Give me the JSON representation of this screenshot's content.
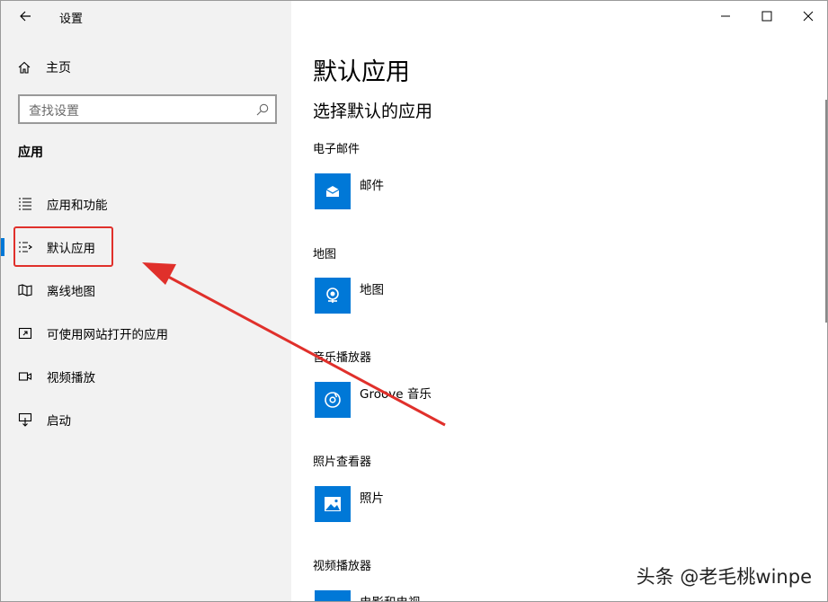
{
  "window": {
    "title": "设置"
  },
  "sidebar": {
    "home_label": "主页",
    "search_placeholder": "查找设置",
    "section_label": "应用",
    "items": [
      {
        "label": "应用和功能",
        "icon": "list-icon"
      },
      {
        "label": "默认应用",
        "icon": "default-apps-icon",
        "active": true
      },
      {
        "label": "离线地图",
        "icon": "map-icon"
      },
      {
        "label": "可使用网站打开的应用",
        "icon": "open-external-icon"
      },
      {
        "label": "视频播放",
        "icon": "video-icon"
      },
      {
        "label": "启动",
        "icon": "startup-icon"
      }
    ]
  },
  "main": {
    "title": "默认应用",
    "subtitle": "选择默认的应用",
    "categories": [
      {
        "label": "电子邮件",
        "app": "邮件",
        "icon": "mail-icon"
      },
      {
        "label": "地图",
        "app": "地图",
        "icon": "maps-icon"
      },
      {
        "label": "音乐播放器",
        "app": "Groove 音乐",
        "icon": "groove-music-icon"
      },
      {
        "label": "照片查看器",
        "app": "照片",
        "icon": "photos-icon"
      },
      {
        "label": "视频播放器",
        "app": "电影和电视",
        "icon": "movies-tv-icon"
      }
    ]
  },
  "watermark": "头条 @老毛桃winpe",
  "colors": {
    "accent": "#0078d7",
    "annotation": "#e0302b",
    "sidebar_bg": "#f2f2f2"
  }
}
